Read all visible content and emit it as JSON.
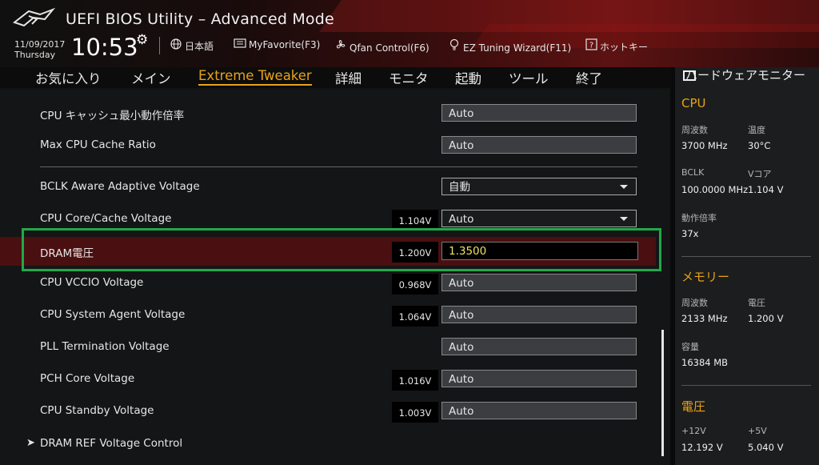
{
  "header": {
    "title": "UEFI BIOS Utility – Advanced Mode",
    "date": "11/09/2017",
    "day": "Thursday",
    "time": "10:53",
    "toolbar": [
      {
        "icon": "globe-icon",
        "label": "日本語"
      },
      {
        "icon": "keyboard-icon",
        "label": "MyFavorite(F3)"
      },
      {
        "icon": "fan-icon",
        "label": "Qfan Control(F6)"
      },
      {
        "icon": "bulb-icon",
        "label": "EZ Tuning Wizard(F11)"
      },
      {
        "icon": "help-icon",
        "label": "ホットキー"
      }
    ]
  },
  "nav": {
    "tabs": [
      "お気に入り",
      "メイン",
      "Extreme Tweaker",
      "詳細",
      "モニタ",
      "起動",
      "ツール",
      "終了"
    ],
    "active": "Extreme Tweaker"
  },
  "settings": [
    {
      "label": "CPU キャッシュ最小動作倍率",
      "reading": "",
      "value": "Auto",
      "type": "input"
    },
    {
      "label": "Max CPU Cache Ratio",
      "reading": "",
      "value": "Auto",
      "type": "input"
    },
    {
      "label": "BCLK Aware Adaptive Voltage",
      "reading": "",
      "value": "自動",
      "type": "dropdown"
    },
    {
      "label": "CPU Core/Cache Voltage",
      "reading": "1.104V",
      "value": "Auto",
      "type": "dropdown"
    },
    {
      "label": "DRAM電圧",
      "reading": "1.200V",
      "value": "1.3500",
      "type": "input",
      "highlighted": true
    },
    {
      "label": "CPU VCCIO Voltage",
      "reading": "0.968V",
      "value": "Auto",
      "type": "input"
    },
    {
      "label": "CPU System Agent Voltage",
      "reading": "1.064V",
      "value": "Auto",
      "type": "input"
    },
    {
      "label": "PLL Termination Voltage",
      "reading": "",
      "value": "Auto",
      "type": "input"
    },
    {
      "label": "PCH Core Voltage",
      "reading": "1.016V",
      "value": "Auto",
      "type": "input"
    },
    {
      "label": "CPU Standby Voltage",
      "reading": "1.003V",
      "value": "Auto",
      "type": "input"
    },
    {
      "label": "DRAM REF Voltage Control",
      "reading": "",
      "value": "",
      "type": "submenu"
    }
  ],
  "hw_monitor": {
    "title": "ハードウェアモニター",
    "cpu": {
      "heading": "CPU",
      "freq_label": "周波数",
      "freq": "3700 MHz",
      "temp_label": "温度",
      "temp": "30°C",
      "bclk_label": "BCLK",
      "bclk": "100.0000 MHz",
      "vcore_label": "Vコア",
      "vcore": "1.104 V",
      "ratio_label": "動作倍率",
      "ratio": "37x"
    },
    "memory": {
      "heading": "メモリー",
      "freq_label": "周波数",
      "freq": "2133 MHz",
      "volt_label": "電圧",
      "volt": "1.200 V",
      "cap_label": "容量",
      "cap": "16384 MB"
    },
    "voltage": {
      "heading": "電圧",
      "v12_label": "+12V",
      "v12": "12.192 V",
      "v5_label": "+5V",
      "v5": "5.040 V"
    }
  }
}
